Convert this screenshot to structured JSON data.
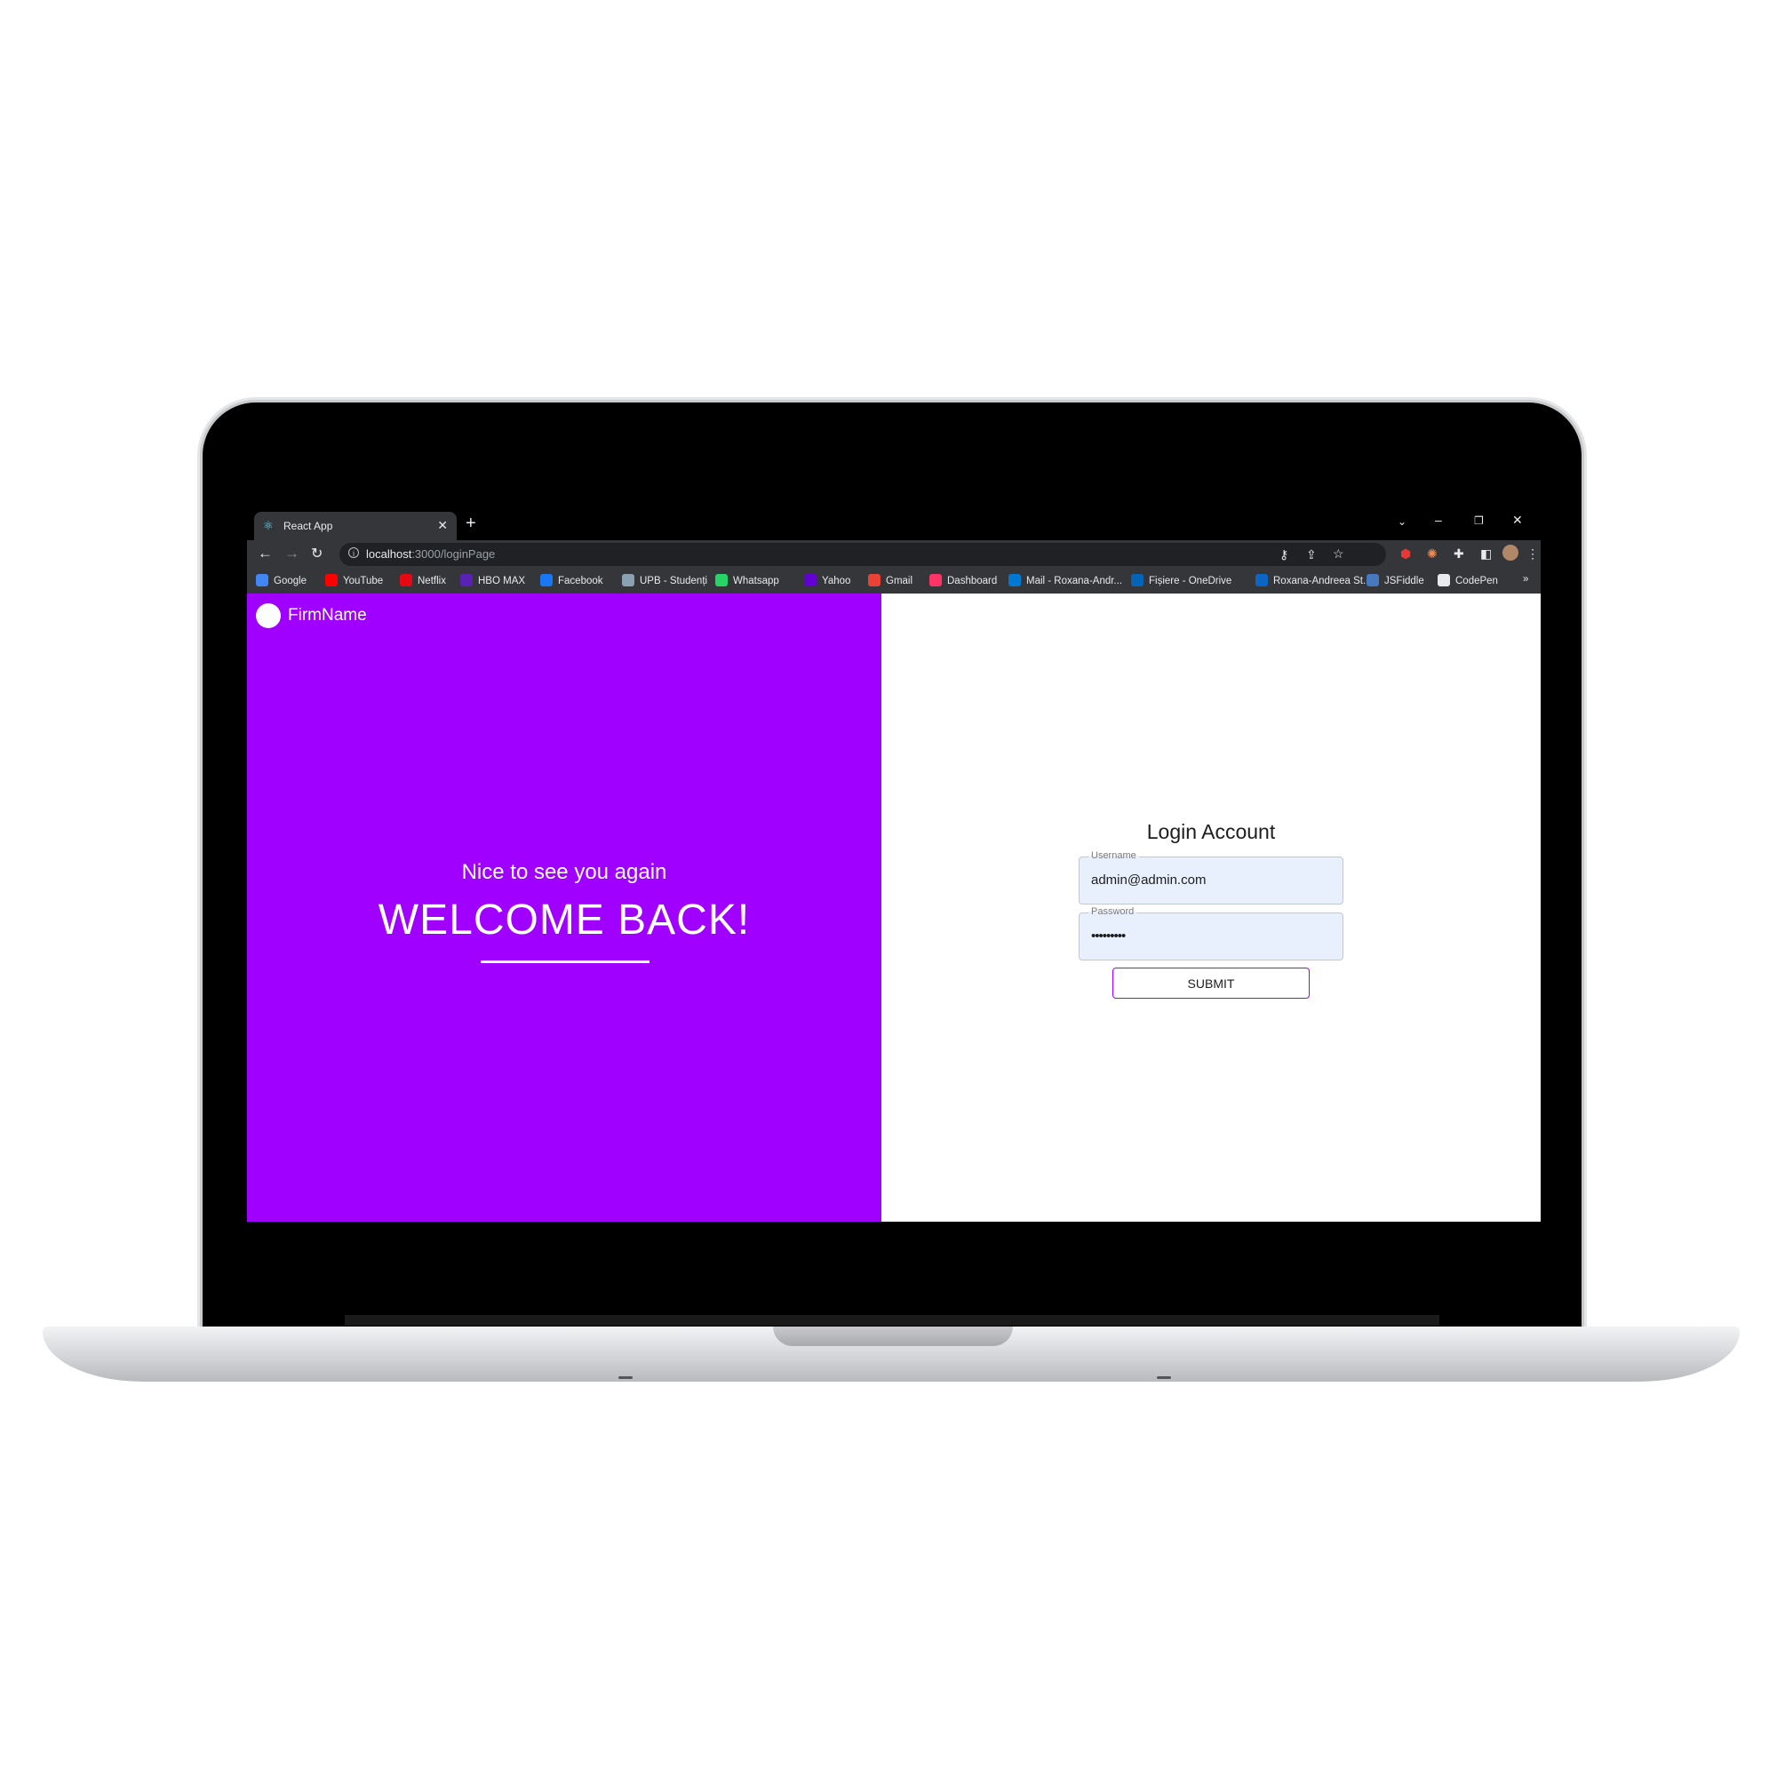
{
  "browser": {
    "tab_title": "React App",
    "new_tab_label": "+",
    "url_host": "localhost",
    "url_path": ":3000/loginPage",
    "bookmarks": [
      {
        "label": "Google",
        "icon": "google-icon",
        "color": "#4285f4"
      },
      {
        "label": "YouTube",
        "icon": "youtube-icon",
        "color": "#ff0000"
      },
      {
        "label": "Netflix",
        "icon": "netflix-icon",
        "color": "#e50914"
      },
      {
        "label": "HBO MAX",
        "icon": "hbo-max-icon",
        "color": "#5822b4"
      },
      {
        "label": "Facebook",
        "icon": "facebook-icon",
        "color": "#1877f2"
      },
      {
        "label": "UPB - Studenți",
        "icon": "upb-icon",
        "color": "#8aa1b1"
      },
      {
        "label": "Whatsapp",
        "icon": "whatsapp-icon",
        "color": "#25d366"
      },
      {
        "label": "Yahoo",
        "icon": "yahoo-icon",
        "color": "#6001d2"
      },
      {
        "label": "Gmail",
        "icon": "gmail-icon",
        "color": "#ea4335"
      },
      {
        "label": "Dashboard",
        "icon": "invision-icon",
        "color": "#ff3366"
      },
      {
        "label": "Mail - Roxana-Andr...",
        "icon": "outlook-icon",
        "color": "#0078d4"
      },
      {
        "label": "Fișiere - OneDrive",
        "icon": "onedrive-icon",
        "color": "#0364b8"
      },
      {
        "label": "Roxana-Andreea St...",
        "icon": "linkedin-icon",
        "color": "#0a66c2"
      },
      {
        "label": "JSFiddle",
        "icon": "jsfiddle-icon",
        "color": "#4679bd"
      },
      {
        "label": "CodePen",
        "icon": "codepen-icon",
        "color": "#e8eaed"
      }
    ],
    "more_bookmarks": "»"
  },
  "app": {
    "brand_color": "#a000ff",
    "firm_name": "FirmName",
    "welcome_subtitle": "Nice to see you again",
    "welcome_title": "WELCOME BACK!",
    "login": {
      "title": "Login Account",
      "username_label": "Username",
      "username_value": "admin@admin.com",
      "password_label": "Password",
      "password_value": "•••••••••",
      "submit_label": "SUBMIT"
    }
  }
}
